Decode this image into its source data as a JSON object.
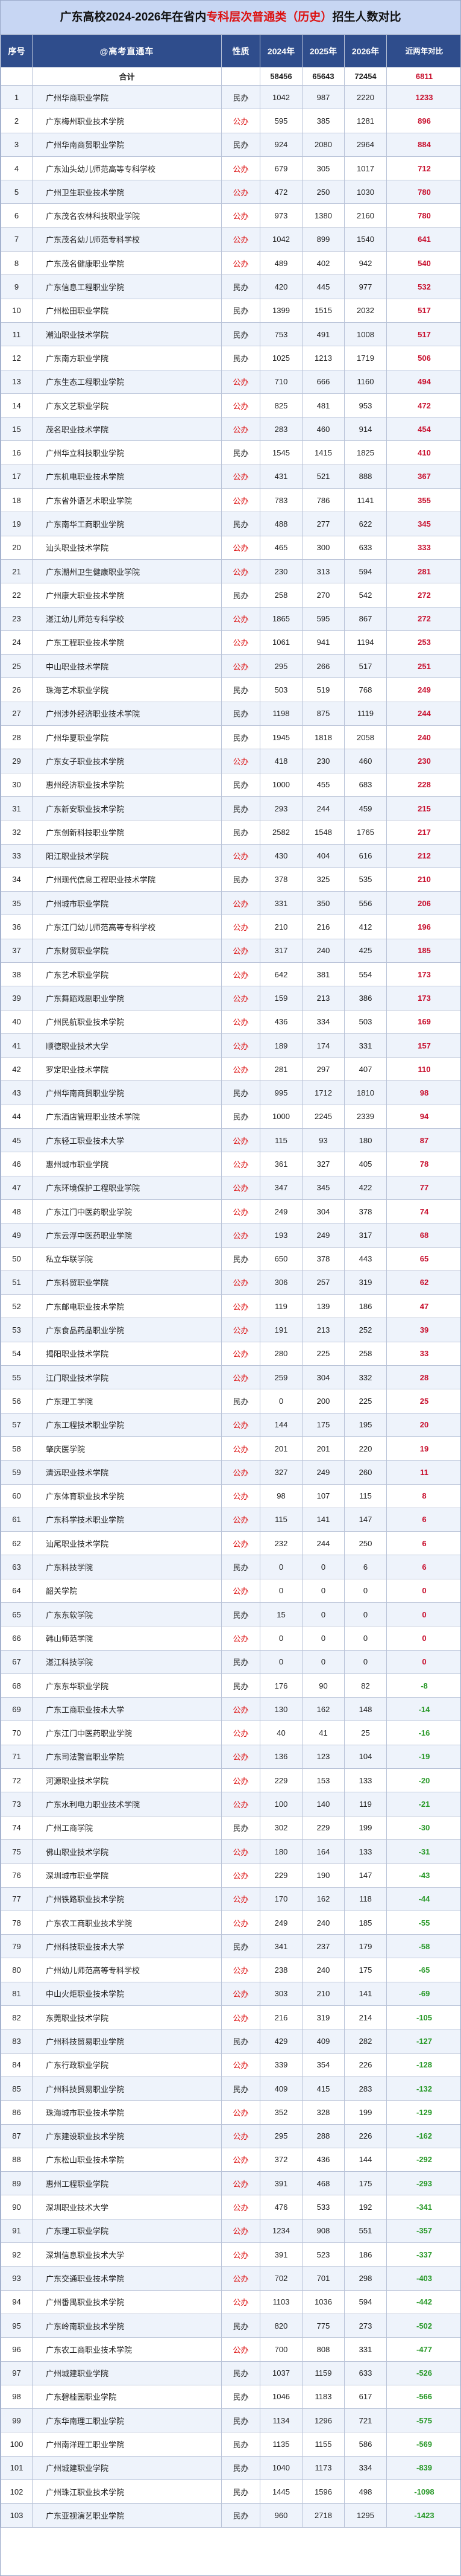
{
  "title_prefix": "广东高校2024-2026年在省内",
  "title_highlight": "专科层次普通类（历史）",
  "title_suffix": "招生人数对比",
  "headers": {
    "no": "序号",
    "school": "@高考直通车",
    "type": "性质",
    "y2024": "2024年",
    "y2025": "2025年",
    "y2026": "2026年",
    "diff": "近两年对比"
  },
  "colors": {
    "public": "#d11111",
    "positive": "#c8102e",
    "negative": "#2a9a2a",
    "header_bg": "#2f4d8c",
    "title_bg": "#c7d6f3"
  },
  "total": {
    "label": "合计",
    "y2024": "58456",
    "y2025": "65643",
    "y2026": "72454",
    "diff": "6811"
  },
  "rows": [
    [
      "1",
      "广州华商职业学院",
      "民办",
      "1042",
      "987",
      "2220",
      "1233"
    ],
    [
      "2",
      "广东梅州职业技术学院",
      "公办",
      "595",
      "385",
      "1281",
      "896"
    ],
    [
      "3",
      "广州华南商贸职业学院",
      "民办",
      "924",
      "2080",
      "2964",
      "884"
    ],
    [
      "4",
      "广东汕头幼儿师范高等专科学校",
      "公办",
      "679",
      "305",
      "1017",
      "712"
    ],
    [
      "5",
      "广州卫生职业技术学院",
      "公办",
      "472",
      "250",
      "1030",
      "780"
    ],
    [
      "6",
      "广东茂名农林科技职业学院",
      "公办",
      "973",
      "1380",
      "2160",
      "780"
    ],
    [
      "7",
      "广东茂名幼儿师范专科学校",
      "公办",
      "1042",
      "899",
      "1540",
      "641"
    ],
    [
      "8",
      "广东茂名健康职业学院",
      "公办",
      "489",
      "402",
      "942",
      "540"
    ],
    [
      "9",
      "广东信息工程职业学院",
      "民办",
      "420",
      "445",
      "977",
      "532"
    ],
    [
      "10",
      "广州松田职业学院",
      "民办",
      "1399",
      "1515",
      "2032",
      "517"
    ],
    [
      "11",
      "潮汕职业技术学院",
      "民办",
      "753",
      "491",
      "1008",
      "517"
    ],
    [
      "12",
      "广东南方职业学院",
      "民办",
      "1025",
      "1213",
      "1719",
      "506"
    ],
    [
      "13",
      "广东生态工程职业学院",
      "公办",
      "710",
      "666",
      "1160",
      "494"
    ],
    [
      "14",
      "广东文艺职业学院",
      "公办",
      "825",
      "481",
      "953",
      "472"
    ],
    [
      "15",
      "茂名职业技术学院",
      "公办",
      "283",
      "460",
      "914",
      "454"
    ],
    [
      "16",
      "广州华立科技职业学院",
      "民办",
      "1545",
      "1415",
      "1825",
      "410"
    ],
    [
      "17",
      "广东机电职业技术学院",
      "公办",
      "431",
      "521",
      "888",
      "367"
    ],
    [
      "18",
      "广东省外语艺术职业学院",
      "公办",
      "783",
      "786",
      "1141",
      "355"
    ],
    [
      "19",
      "广东南华工商职业学院",
      "民办",
      "488",
      "277",
      "622",
      "345"
    ],
    [
      "20",
      "汕头职业技术学院",
      "公办",
      "465",
      "300",
      "633",
      "333"
    ],
    [
      "21",
      "广东潮州卫生健康职业学院",
      "公办",
      "230",
      "313",
      "594",
      "281"
    ],
    [
      "22",
      "广州康大职业技术学院",
      "民办",
      "258",
      "270",
      "542",
      "272"
    ],
    [
      "23",
      "湛江幼儿师范专科学校",
      "公办",
      "1865",
      "595",
      "867",
      "272"
    ],
    [
      "24",
      "广东工程职业技术学院",
      "公办",
      "1061",
      "941",
      "1194",
      "253"
    ],
    [
      "25",
      "中山职业技术学院",
      "公办",
      "295",
      "266",
      "517",
      "251"
    ],
    [
      "26",
      "珠海艺术职业学院",
      "民办",
      "503",
      "519",
      "768",
      "249"
    ],
    [
      "27",
      "广州涉外经济职业技术学院",
      "民办",
      "1198",
      "875",
      "1119",
      "244"
    ],
    [
      "28",
      "广州华夏职业学院",
      "民办",
      "1945",
      "1818",
      "2058",
      "240"
    ],
    [
      "29",
      "广东女子职业技术学院",
      "公办",
      "418",
      "230",
      "460",
      "230"
    ],
    [
      "30",
      "惠州经济职业技术学院",
      "民办",
      "1000",
      "455",
      "683",
      "228"
    ],
    [
      "31",
      "广东新安职业技术学院",
      "民办",
      "293",
      "244",
      "459",
      "215"
    ],
    [
      "32",
      "广东创新科技职业学院",
      "民办",
      "2582",
      "1548",
      "1765",
      "217"
    ],
    [
      "33",
      "阳江职业技术学院",
      "公办",
      "430",
      "404",
      "616",
      "212"
    ],
    [
      "34",
      "广州现代信息工程职业技术学院",
      "民办",
      "378",
      "325",
      "535",
      "210"
    ],
    [
      "35",
      "广州城市职业学院",
      "公办",
      "331",
      "350",
      "556",
      "206"
    ],
    [
      "36",
      "广东江门幼儿师范高等专科学校",
      "公办",
      "210",
      "216",
      "412",
      "196"
    ],
    [
      "37",
      "广东财贸职业学院",
      "公办",
      "317",
      "240",
      "425",
      "185"
    ],
    [
      "38",
      "广东艺术职业学院",
      "公办",
      "642",
      "381",
      "554",
      "173"
    ],
    [
      "39",
      "广东舞蹈戏剧职业学院",
      "公办",
      "159",
      "213",
      "386",
      "173"
    ],
    [
      "40",
      "广州民航职业技术学院",
      "公办",
      "436",
      "334",
      "503",
      "169"
    ],
    [
      "41",
      "顺德职业技术大学",
      "公办",
      "189",
      "174",
      "331",
      "157"
    ],
    [
      "42",
      "罗定职业技术学院",
      "公办",
      "281",
      "297",
      "407",
      "110"
    ],
    [
      "43",
      "广州华南商贸职业学院",
      "民办",
      "995",
      "1712",
      "1810",
      "98"
    ],
    [
      "44",
      "广东酒店管理职业技术学院",
      "民办",
      "1000",
      "2245",
      "2339",
      "94"
    ],
    [
      "45",
      "广东轻工职业技术大学",
      "公办",
      "115",
      "93",
      "180",
      "87"
    ],
    [
      "46",
      "惠州城市职业学院",
      "公办",
      "361",
      "327",
      "405",
      "78"
    ],
    [
      "47",
      "广东环境保护工程职业学院",
      "公办",
      "347",
      "345",
      "422",
      "77"
    ],
    [
      "48",
      "广东江门中医药职业学院",
      "公办",
      "249",
      "304",
      "378",
      "74"
    ],
    [
      "49",
      "广东云浮中医药职业学院",
      "公办",
      "193",
      "249",
      "317",
      "68"
    ],
    [
      "50",
      "私立华联学院",
      "民办",
      "650",
      "378",
      "443",
      "65"
    ],
    [
      "51",
      "广东科贸职业学院",
      "公办",
      "306",
      "257",
      "319",
      "62"
    ],
    [
      "52",
      "广东邮电职业技术学院",
      "公办",
      "119",
      "139",
      "186",
      "47"
    ],
    [
      "53",
      "广东食品药品职业学院",
      "公办",
      "191",
      "213",
      "252",
      "39"
    ],
    [
      "54",
      "揭阳职业技术学院",
      "公办",
      "280",
      "225",
      "258",
      "33"
    ],
    [
      "55",
      "江门职业技术学院",
      "公办",
      "259",
      "304",
      "332",
      "28"
    ],
    [
      "56",
      "广东理工学院",
      "民办",
      "0",
      "200",
      "225",
      "25"
    ],
    [
      "57",
      "广东工程技术职业学院",
      "公办",
      "144",
      "175",
      "195",
      "20"
    ],
    [
      "58",
      "肇庆医学院",
      "公办",
      "201",
      "201",
      "220",
      "19"
    ],
    [
      "59",
      "清远职业技术学院",
      "公办",
      "327",
      "249",
      "260",
      "11"
    ],
    [
      "60",
      "广东体育职业技术学院",
      "公办",
      "98",
      "107",
      "115",
      "8"
    ],
    [
      "61",
      "广东科学技术职业学院",
      "公办",
      "115",
      "141",
      "147",
      "6"
    ],
    [
      "62",
      "汕尾职业技术学院",
      "公办",
      "232",
      "244",
      "250",
      "6"
    ],
    [
      "63",
      "广东科技学院",
      "民办",
      "0",
      "0",
      "6",
      "6"
    ],
    [
      "64",
      "韶关学院",
      "公办",
      "0",
      "0",
      "0",
      "0"
    ],
    [
      "65",
      "广东东软学院",
      "民办",
      "15",
      "0",
      "0",
      "0"
    ],
    [
      "66",
      "韩山师范学院",
      "公办",
      "0",
      "0",
      "0",
      "0"
    ],
    [
      "67",
      "湛江科技学院",
      "民办",
      "0",
      "0",
      "0",
      "0"
    ],
    [
      "68",
      "广东东华职业学院",
      "民办",
      "176",
      "90",
      "82",
      "-8"
    ],
    [
      "69",
      "广东工商职业技术大学",
      "公办",
      "130",
      "162",
      "148",
      "-14"
    ],
    [
      "70",
      "广东江门中医药职业学院",
      "公办",
      "40",
      "41",
      "25",
      "-16"
    ],
    [
      "71",
      "广东司法警官职业学院",
      "公办",
      "136",
      "123",
      "104",
      "-19"
    ],
    [
      "72",
      "河源职业技术学院",
      "公办",
      "229",
      "153",
      "133",
      "-20"
    ],
    [
      "73",
      "广东水利电力职业技术学院",
      "公办",
      "100",
      "140",
      "119",
      "-21"
    ],
    [
      "74",
      "广州工商学院",
      "民办",
      "302",
      "229",
      "199",
      "-30"
    ],
    [
      "75",
      "佛山职业技术学院",
      "公办",
      "180",
      "164",
      "133",
      "-31"
    ],
    [
      "76",
      "深圳城市职业学院",
      "公办",
      "229",
      "190",
      "147",
      "-43"
    ],
    [
      "77",
      "广州铁路职业技术学院",
      "公办",
      "170",
      "162",
      "118",
      "-44"
    ],
    [
      "78",
      "广东农工商职业技术学院",
      "公办",
      "249",
      "240",
      "185",
      "-55"
    ],
    [
      "79",
      "广州科技职业技术大学",
      "民办",
      "341",
      "237",
      "179",
      "-58"
    ],
    [
      "80",
      "广州幼儿师范高等专科学校",
      "公办",
      "238",
      "240",
      "175",
      "-65"
    ],
    [
      "81",
      "中山火炬职业技术学院",
      "公办",
      "303",
      "210",
      "141",
      "-69"
    ],
    [
      "82",
      "东莞职业技术学院",
      "公办",
      "216",
      "319",
      "214",
      "-105"
    ],
    [
      "83",
      "广州科技贸易职业学院",
      "民办",
      "429",
      "409",
      "282",
      "-127"
    ],
    [
      "84",
      "广东行政职业学院",
      "公办",
      "339",
      "354",
      "226",
      "-128"
    ],
    [
      "85",
      "广州科技贸易职业学院",
      "民办",
      "409",
      "415",
      "283",
      "-132"
    ],
    [
      "86",
      "珠海城市职业技术学院",
      "公办",
      "352",
      "328",
      "199",
      "-129"
    ],
    [
      "87",
      "广东建设职业技术学院",
      "公办",
      "295",
      "288",
      "226",
      "-162"
    ],
    [
      "88",
      "广东松山职业技术学院",
      "公办",
      "372",
      "436",
      "144",
      "-292"
    ],
    [
      "89",
      "惠州工程职业学院",
      "公办",
      "391",
      "468",
      "175",
      "-293"
    ],
    [
      "90",
      "深圳职业技术大学",
      "公办",
      "476",
      "533",
      "192",
      "-341"
    ],
    [
      "91",
      "广东理工职业学院",
      "公办",
      "1234",
      "908",
      "551",
      "-357"
    ],
    [
      "92",
      "深圳信息职业技术大学",
      "公办",
      "391",
      "523",
      "186",
      "-337"
    ],
    [
      "93",
      "广东交通职业技术学院",
      "公办",
      "702",
      "701",
      "298",
      "-403"
    ],
    [
      "94",
      "广州番禺职业技术学院",
      "公办",
      "1103",
      "1036",
      "594",
      "-442"
    ],
    [
      "95",
      "广东岭南职业技术学院",
      "民办",
      "820",
      "775",
      "273",
      "-502"
    ],
    [
      "96",
      "广东农工商职业技术学院",
      "公办",
      "700",
      "808",
      "331",
      "-477"
    ],
    [
      "97",
      "广州城建职业学院",
      "民办",
      "1037",
      "1159",
      "633",
      "-526"
    ],
    [
      "98",
      "广东碧桂园职业学院",
      "民办",
      "1046",
      "1183",
      "617",
      "-566"
    ],
    [
      "99",
      "广东华南理工职业学院",
      "民办",
      "1134",
      "1296",
      "721",
      "-575"
    ],
    [
      "100",
      "广州南洋理工职业学院",
      "民办",
      "1135",
      "1155",
      "586",
      "-569"
    ],
    [
      "101",
      "广州城建职业学院",
      "民办",
      "1040",
      "1173",
      "334",
      "-839"
    ],
    [
      "102",
      "广州珠江职业技术学院",
      "民办",
      "1445",
      "1596",
      "498",
      "-1098"
    ],
    [
      "103",
      "广东亚视演艺职业学院",
      "民办",
      "960",
      "2718",
      "1295",
      "-1423"
    ]
  ]
}
